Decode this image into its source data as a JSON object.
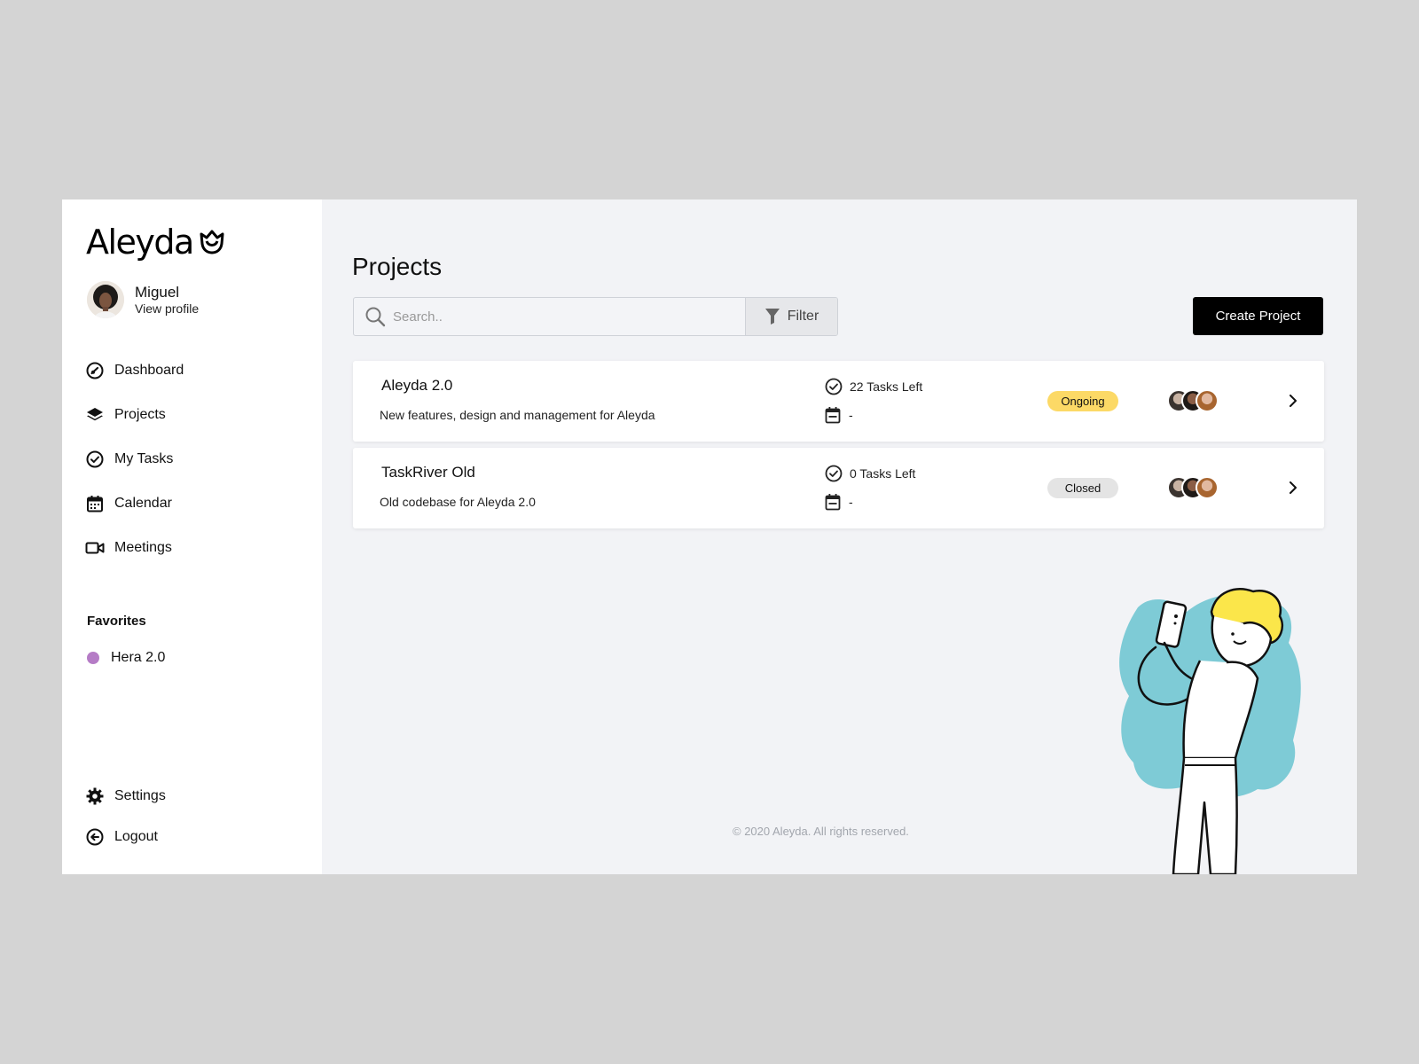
{
  "brand": {
    "name": "Aleyda"
  },
  "user": {
    "name": "Miguel",
    "profile_link": "View profile"
  },
  "nav": [
    {
      "label": "Dashboard",
      "icon": "dashboard-gauge-icon"
    },
    {
      "label": "Projects",
      "icon": "layers-icon"
    },
    {
      "label": "My Tasks",
      "icon": "check-circle-icon"
    },
    {
      "label": "Calendar",
      "icon": "calendar-icon"
    },
    {
      "label": "Meetings",
      "icon": "video-camera-icon"
    }
  ],
  "favorites": {
    "title": "Favorites",
    "items": [
      {
        "label": "Hera 2.0",
        "color": "#b57cc6"
      }
    ]
  },
  "bottom_nav": [
    {
      "label": "Settings",
      "icon": "gear-icon"
    },
    {
      "label": "Logout",
      "icon": "logout-icon"
    }
  ],
  "main": {
    "title": "Projects",
    "search": {
      "placeholder": "Search.."
    },
    "filter_label": "Filter",
    "create_label": "Create Project"
  },
  "projects": [
    {
      "name": "Aleyda 2.0",
      "description": "New features, design and management for Aleyda",
      "tasks": "22 Tasks Left",
      "date": "-",
      "status": "Ongoing",
      "status_color": "#fcd966"
    },
    {
      "name": "TaskRiver Old",
      "description": "Old codebase for Aleyda 2.0",
      "tasks": "0 Tasks Left",
      "date": "-",
      "status": "Closed",
      "status_color": "#e4e4e4"
    }
  ],
  "footer": "© 2020 Aleyda. All rights reserved.",
  "colors": {
    "accent": "#000000",
    "illustration_blob": "#7ecbd6",
    "illustration_hair": "#fbe64a"
  }
}
